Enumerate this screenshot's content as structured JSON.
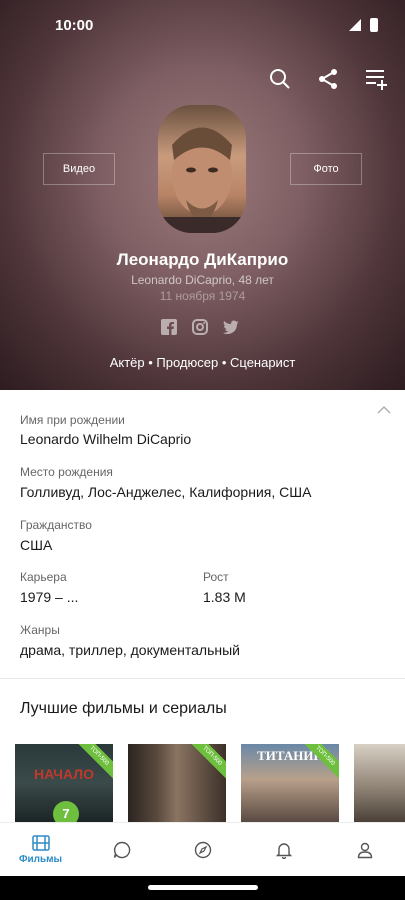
{
  "status": {
    "time": "10:00"
  },
  "profile": {
    "name": "Леонардо ДиКаприо",
    "original_name_age": "Leonardo DiCaprio, 48 лет",
    "birth_date": "11 ноября 1974",
    "roles": "Актёр • Продюсер • Сценарист",
    "video_label": "Видео",
    "photo_label": "Фото"
  },
  "info": {
    "birth_name_label": "Имя при рождении",
    "birth_name": "Leonardo Wilhelm DiCaprio",
    "birthplace_label": "Место рождения",
    "birthplace": "Голливуд, Лос-Анджелес, Калифорния, США",
    "citizenship_label": "Гражданство",
    "citizenship": "США",
    "career_label": "Карьера",
    "career": "1979 – ...",
    "height_label": "Рост",
    "height": "1.83 М",
    "genres_label": "Жанры",
    "genres": "драма, триллер, документальный"
  },
  "best_section": {
    "title": "Лучшие фильмы и сериалы",
    "posters": [
      {
        "title": "НАЧАЛО",
        "badge": "ТОП-500",
        "rating": "7"
      },
      {
        "title": "",
        "badge": "ТОП-500",
        "rating": ""
      },
      {
        "title": "ТИТАНИК",
        "badge": "ТОП-500",
        "rating": ""
      },
      {
        "title": "",
        "badge": "",
        "rating": ""
      }
    ]
  },
  "nav": {
    "films_label": "Фильмы"
  },
  "colors": {
    "accent": "#2e8cc7",
    "badge": "#6fbf3f"
  }
}
